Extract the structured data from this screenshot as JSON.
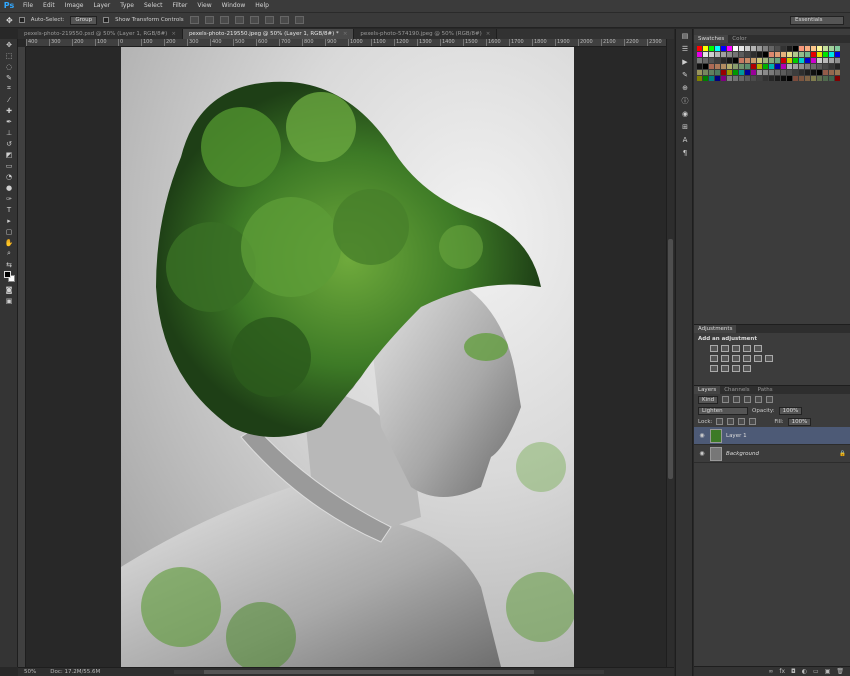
{
  "app": {
    "logo": "Ps"
  },
  "menu": [
    "File",
    "Edit",
    "Image",
    "Layer",
    "Type",
    "Select",
    "Filter",
    "View",
    "Window",
    "Help"
  ],
  "options": {
    "auto_select_label": "Auto-Select:",
    "auto_select_value": "Group",
    "show_transform_label": "Show Transform Controls",
    "workspace": "Essentials"
  },
  "tabs": [
    {
      "label": "pexels-photo-219550.psd @ 50% (Layer 1, RGB/8#)",
      "active": false
    },
    {
      "label": "pexels-photo-219550.jpeg @ 50% (Layer 1, RGB/8#) *",
      "active": true
    },
    {
      "label": "pexels-photo-574190.jpeg @ 50% (RGB/8#)",
      "active": false
    }
  ],
  "ruler_ticks": [
    "400",
    "300",
    "200",
    "100",
    "0",
    "100",
    "200",
    "300",
    "400",
    "500",
    "600",
    "700",
    "800",
    "900",
    "1000",
    "1100",
    "1200",
    "1300",
    "1400",
    "1500",
    "1600",
    "1700",
    "1800",
    "1900",
    "2000",
    "2100",
    "2200",
    "2300"
  ],
  "status": {
    "zoom": "50%",
    "doc": "Doc: 17.2M/55.6M"
  },
  "swatches": {
    "tabs": [
      "Swatches",
      "Color"
    ]
  },
  "adjustments": {
    "tab": "Adjustments",
    "title": "Add an adjustment"
  },
  "layers": {
    "tabs": [
      "Layers",
      "Channels",
      "Paths"
    ],
    "kind": "Kind",
    "blend_mode": "Lighten",
    "opacity_label": "Opacity:",
    "opacity": "100%",
    "lock_label": "Lock:",
    "fill_label": "Fill:",
    "fill": "100%",
    "items": [
      {
        "name": "Layer 1",
        "selected": true
      },
      {
        "name": "Background",
        "selected": false
      }
    ]
  }
}
